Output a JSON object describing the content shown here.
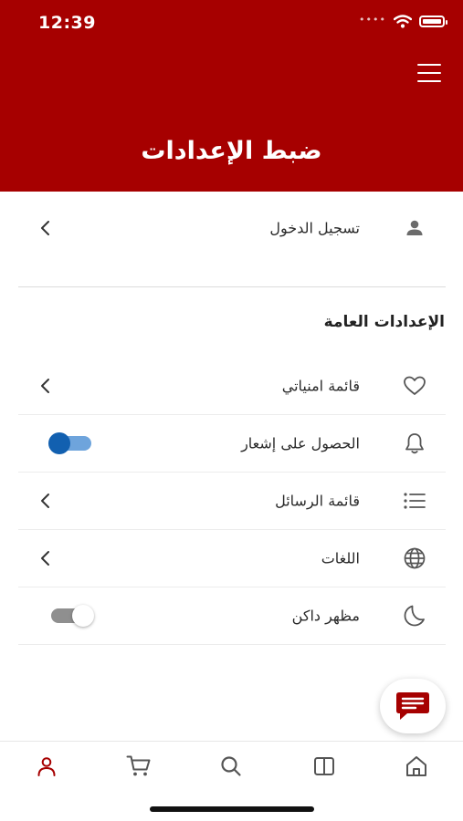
{
  "status_bar": {
    "time": "12:39"
  },
  "header": {
    "title": "ضبط الإعدادات",
    "menu_icon": "hamburger-menu-icon",
    "background": "#a60000"
  },
  "account": {
    "login_label": "تسجيل الدخول"
  },
  "general": {
    "section_title": "الإعدادات العامة",
    "items": [
      {
        "label": "قائمة امنياتي",
        "icon": "heart-icon",
        "control": "chevron"
      },
      {
        "label": "الحصول على إشعار",
        "icon": "bell-icon",
        "control": "toggle",
        "state": "on"
      },
      {
        "label": "قائمة الرسائل",
        "icon": "list-icon",
        "control": "chevron"
      },
      {
        "label": "اللغات",
        "icon": "globe-icon",
        "control": "chevron"
      },
      {
        "label": "مظهر داكن",
        "icon": "moon-icon",
        "control": "toggle",
        "state": "off"
      }
    ]
  },
  "chat_fab": {
    "icon": "chat-icon",
    "color": "#a60000"
  },
  "bottom_nav": [
    {
      "icon": "profile-icon",
      "active": true,
      "color": "#a60000"
    },
    {
      "icon": "cart-icon",
      "active": false
    },
    {
      "icon": "search-icon",
      "active": false
    },
    {
      "icon": "book-icon",
      "active": false
    },
    {
      "icon": "home-icon",
      "active": false
    }
  ]
}
